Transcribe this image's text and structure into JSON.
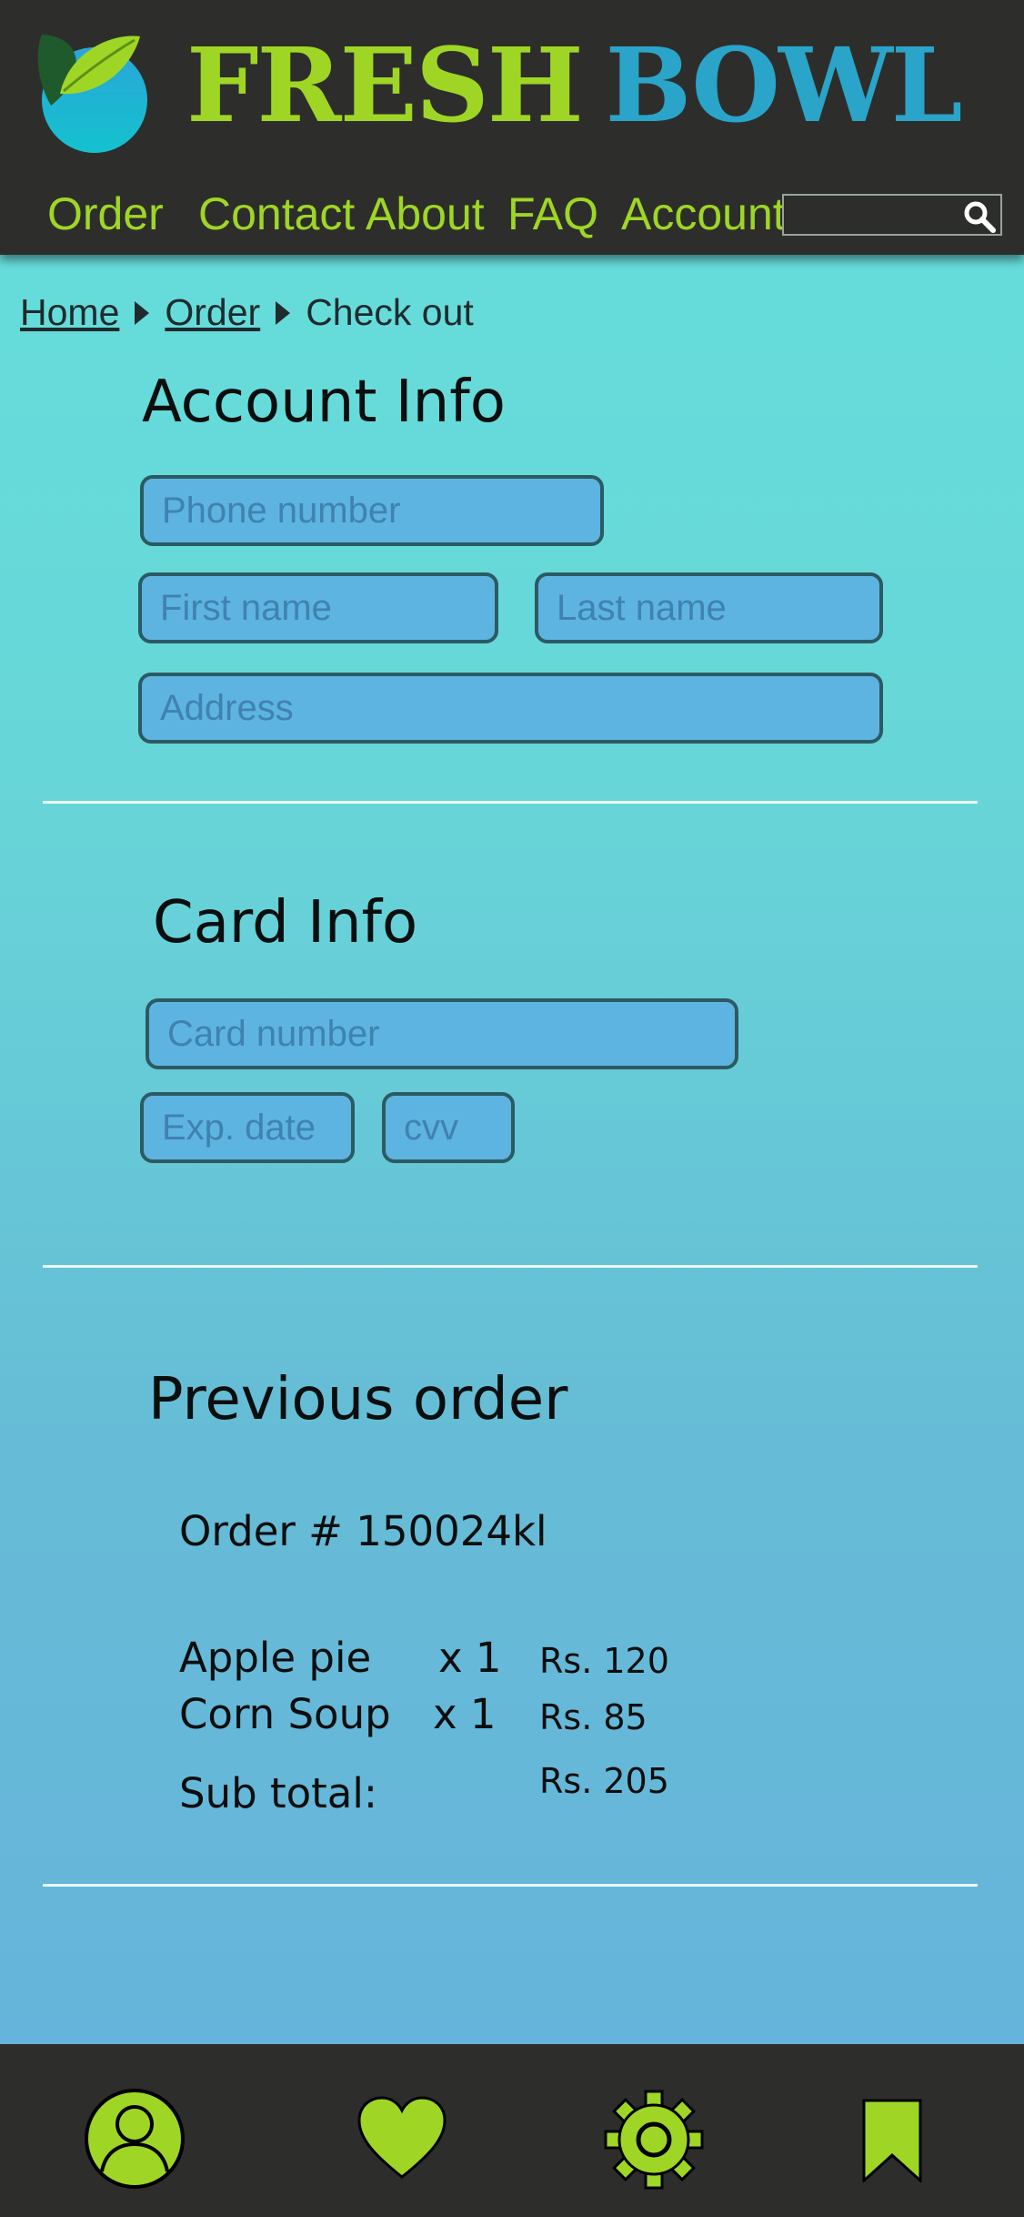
{
  "header": {
    "brand_word1": "FRESH",
    "brand_word2": "BOWL",
    "nav": [
      "Order",
      "Contact",
      "About",
      "FAQ",
      "Account"
    ],
    "search_placeholder": ""
  },
  "breadcrumb": {
    "items": [
      "Home",
      "Order"
    ],
    "current": "Check out"
  },
  "account": {
    "title": "Account Info",
    "phone_placeholder": "Phone number",
    "first_name_placeholder": "First name",
    "last_name_placeholder": "Last name",
    "address_placeholder": "Address"
  },
  "card": {
    "title": "Card Info",
    "card_number_placeholder": "Card number",
    "exp_placeholder": "Exp. date",
    "cvv_placeholder": "cvv"
  },
  "previous_order": {
    "title": "Previous order",
    "order_label": "Order  # 150024kl",
    "items": [
      {
        "name": "Apple pie",
        "qty": "x 1",
        "price": "Rs. 120"
      },
      {
        "name": "Corn Soup",
        "qty": "x 1",
        "price": "Rs. 85"
      }
    ],
    "subtotal_label": "Sub total:",
    "subtotal_value": "Rs. 205"
  },
  "footer": {
    "icons": [
      "profile-icon",
      "heart-icon",
      "gear-icon",
      "bookmark-icon"
    ]
  },
  "colors": {
    "header_bg": "#2d2e2b",
    "accent_green": "#9fd626",
    "accent_blue": "#2aa4c8",
    "field_fill": "#5db4e1",
    "field_border": "#2c5a62"
  }
}
